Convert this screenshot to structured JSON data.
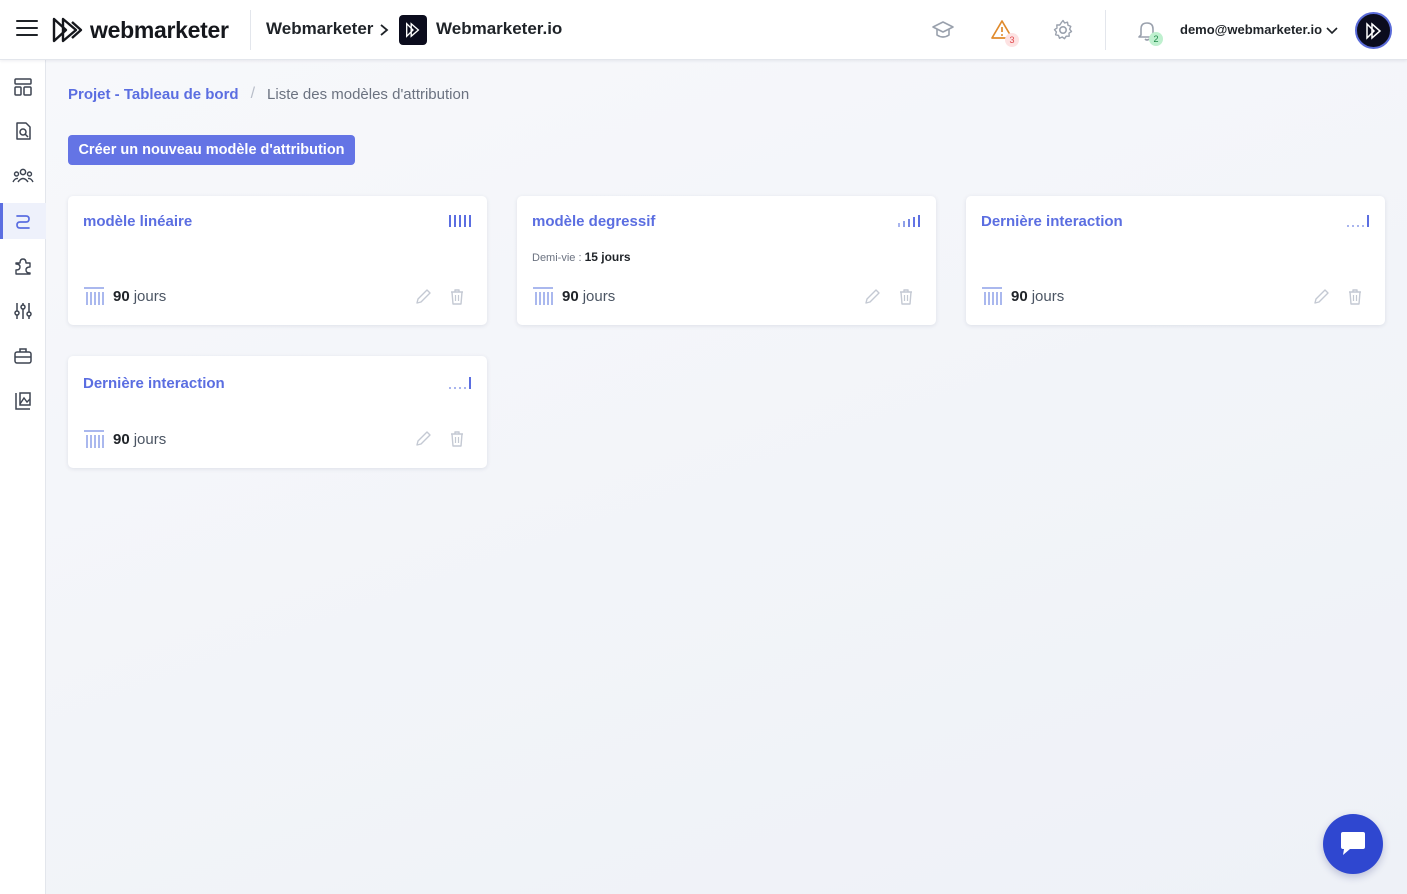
{
  "header": {
    "brand": "webmarketer",
    "org": "Webmarketer",
    "project": "Webmarketer.io",
    "alerts_count": "3",
    "notifications_count": "2",
    "user_email": "demo@webmarketer.io"
  },
  "sidebar": {
    "items": [
      {
        "icon": "dashboard-icon"
      },
      {
        "icon": "search-report-icon"
      },
      {
        "icon": "audience-icon"
      },
      {
        "icon": "attribution-icon",
        "active": true
      },
      {
        "icon": "integrations-icon"
      },
      {
        "icon": "settings-sliders-icon"
      },
      {
        "icon": "briefcase-icon"
      },
      {
        "icon": "media-icon"
      }
    ]
  },
  "breadcrumb": {
    "parent": "Projet - Tableau de bord",
    "current": "Liste des modèles d'attribution"
  },
  "actions": {
    "create_label": "Créer un nouveau modèle d'attribution"
  },
  "models": [
    {
      "title": "modèle linéaire",
      "type": "linear",
      "window_value": "90",
      "window_unit": "jours"
    },
    {
      "title": "modèle degressif",
      "type": "decreasing",
      "half_life_label": "Demi-vie :",
      "half_life_value": "15 jours",
      "window_value": "90",
      "window_unit": "jours"
    },
    {
      "title": "Dernière interaction",
      "type": "last-interaction",
      "window_value": "90",
      "window_unit": "jours"
    },
    {
      "title": "Dernière interaction",
      "type": "last-interaction",
      "window_value": "90",
      "window_unit": "jours"
    }
  ],
  "colors": {
    "accent": "#5b6ee1",
    "button": "#6474e5",
    "chat": "#2f47d0"
  }
}
